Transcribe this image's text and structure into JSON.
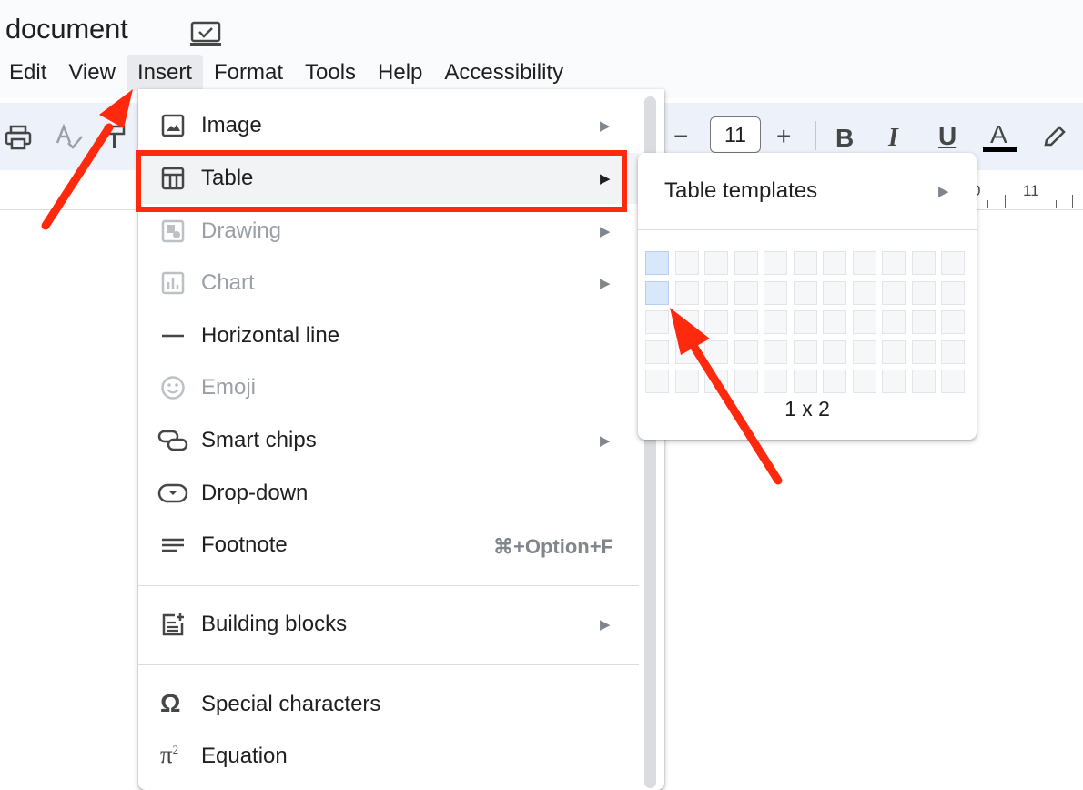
{
  "document": {
    "title": "document"
  },
  "menubar": {
    "items": [
      "Edit",
      "View",
      "Insert",
      "Format",
      "Tools",
      "Help",
      "Accessibility"
    ]
  },
  "toolbar": {
    "font_size": "11",
    "bold": "B",
    "italic": "I",
    "underline": "U",
    "text_color": "A",
    "minus": "−",
    "plus": "+"
  },
  "ruler": {
    "number": "11",
    "partial": "0"
  },
  "insert_menu": {
    "items": [
      {
        "label": "Image",
        "icon": "image-icon",
        "submenu": true,
        "disabled": false
      },
      {
        "label": "Table",
        "icon": "table-icon",
        "submenu": true,
        "disabled": false,
        "highlighted": true
      },
      {
        "label": "Drawing",
        "icon": "drawing-icon",
        "submenu": true,
        "disabled": true
      },
      {
        "label": "Chart",
        "icon": "chart-icon",
        "submenu": true,
        "disabled": true
      },
      {
        "label": "Horizontal line",
        "icon": "horizontal-line-icon",
        "submenu": false,
        "disabled": false
      },
      {
        "label": "Emoji",
        "icon": "emoji-icon",
        "submenu": false,
        "disabled": true
      },
      {
        "label": "Smart chips",
        "icon": "smart-chips-icon",
        "submenu": true,
        "disabled": false
      },
      {
        "label": "Drop-down",
        "icon": "dropdown-icon",
        "submenu": false,
        "disabled": false
      },
      {
        "label": "Footnote",
        "icon": "footnote-icon",
        "submenu": false,
        "disabled": false,
        "shortcut": "⌘+Option+F"
      },
      {
        "label": "Building blocks",
        "icon": "building-blocks-icon",
        "submenu": true,
        "disabled": false
      },
      {
        "label": "Special characters",
        "icon": "omega-icon",
        "submenu": false,
        "disabled": false
      },
      {
        "label": "Equation",
        "icon": "equation-icon",
        "submenu": false,
        "disabled": false
      }
    ]
  },
  "table_submenu": {
    "templates_label": "Table templates",
    "grid_columns": 11,
    "grid_rows": 5,
    "selected_columns": 1,
    "selected_rows": 2,
    "size_label": "1 x 2"
  },
  "colors": {
    "annotation": "#ff2a0e",
    "selected_cell": "#d9e7fb"
  }
}
